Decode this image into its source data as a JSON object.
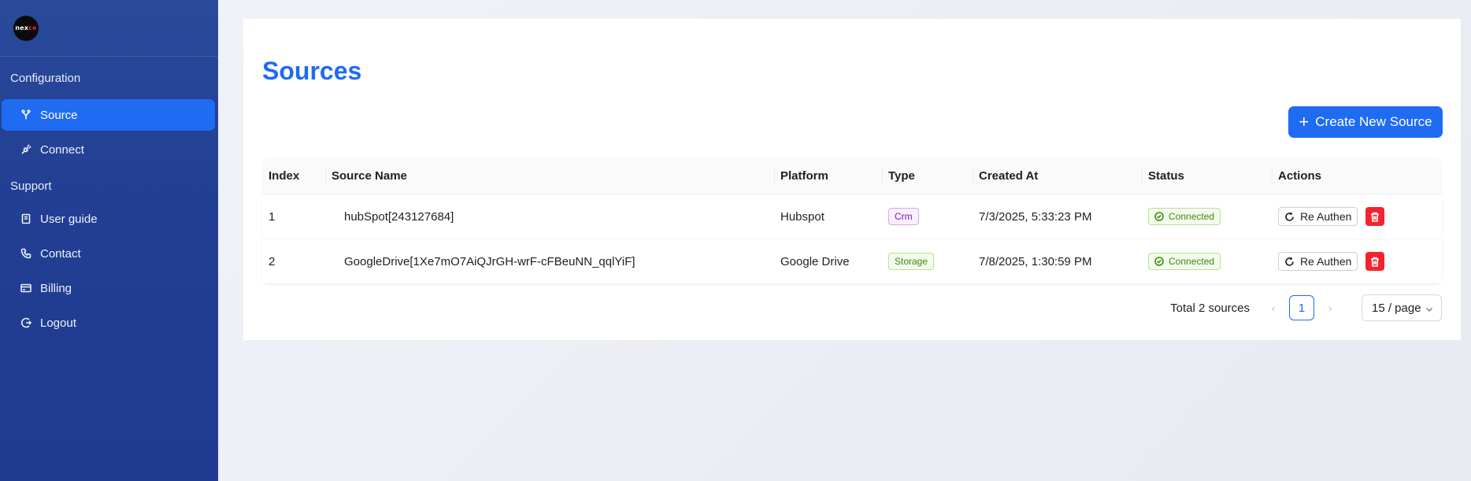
{
  "brand": {
    "logo_text_left": "nex",
    "logo_text_right": "ce"
  },
  "sidebar": {
    "sections": [
      {
        "label": "Configuration"
      },
      {
        "label": "Support"
      }
    ],
    "items": [
      {
        "label": "Source",
        "icon": "fork-icon",
        "active": true
      },
      {
        "label": "Connect",
        "icon": "plug-icon"
      },
      {
        "label": "User guide",
        "icon": "book-icon"
      },
      {
        "label": "Contact",
        "icon": "phone-icon"
      },
      {
        "label": "Billing",
        "icon": "card-icon"
      },
      {
        "label": "Logout",
        "icon": "logout-icon"
      }
    ]
  },
  "page": {
    "title": "Sources",
    "create_button": "Create New Source"
  },
  "table": {
    "headers": [
      "Index",
      "Source Name",
      "Platform",
      "Type",
      "Created At",
      "Status",
      "Actions"
    ],
    "rows": [
      {
        "index": "1",
        "name": "hubSpot[243127684]",
        "platform": "Hubspot",
        "type": "Crm",
        "created": "7/3/2025, 5:33:23 PM",
        "status": "Connected",
        "action": "Re Authen"
      },
      {
        "index": "2",
        "name": "GoogleDrive[1Xe7mO7AiQJrGH-wrF-cFBeuNN_qqlYiF]",
        "platform": "Google Drive",
        "type": "Storage",
        "created": "7/8/2025, 1:30:59 PM",
        "status": "Connected",
        "action": "Re Authen"
      }
    ]
  },
  "pagination": {
    "total": "Total 2 sources",
    "current_page": "1",
    "page_size": "15 / page"
  },
  "colors": {
    "accent": "#1f6bf2",
    "sidebar": "#223f94",
    "danger": "#f5222d",
    "success": "#3a8b12"
  }
}
